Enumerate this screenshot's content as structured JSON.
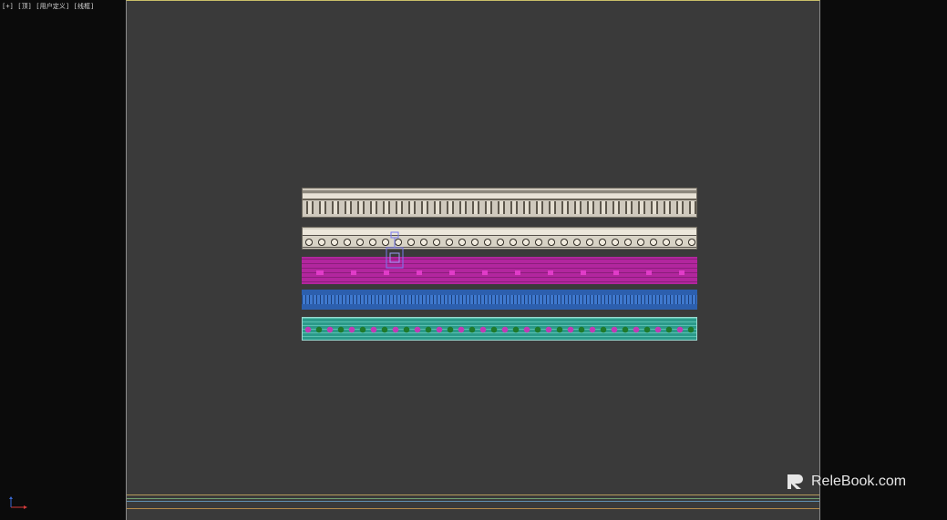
{
  "viewport": {
    "label": "[+] [顶] [用户定义] [线框]"
  },
  "watermark": {
    "text": "ReleBook.com"
  },
  "colors": {
    "viewport_bg": "#3a3a3a",
    "outer_bg": "#0b0b0b",
    "active_border": "#c9bf68",
    "strip_cream": "#cfc9bd",
    "strip_magenta": "#b2269e",
    "strip_blue": "#2c5fae",
    "strip_teal": "#2b9a8a"
  },
  "icons": [
    "axis-gizmo-icon",
    "transform-gizmo-icon",
    "relebook-logo-icon"
  ]
}
